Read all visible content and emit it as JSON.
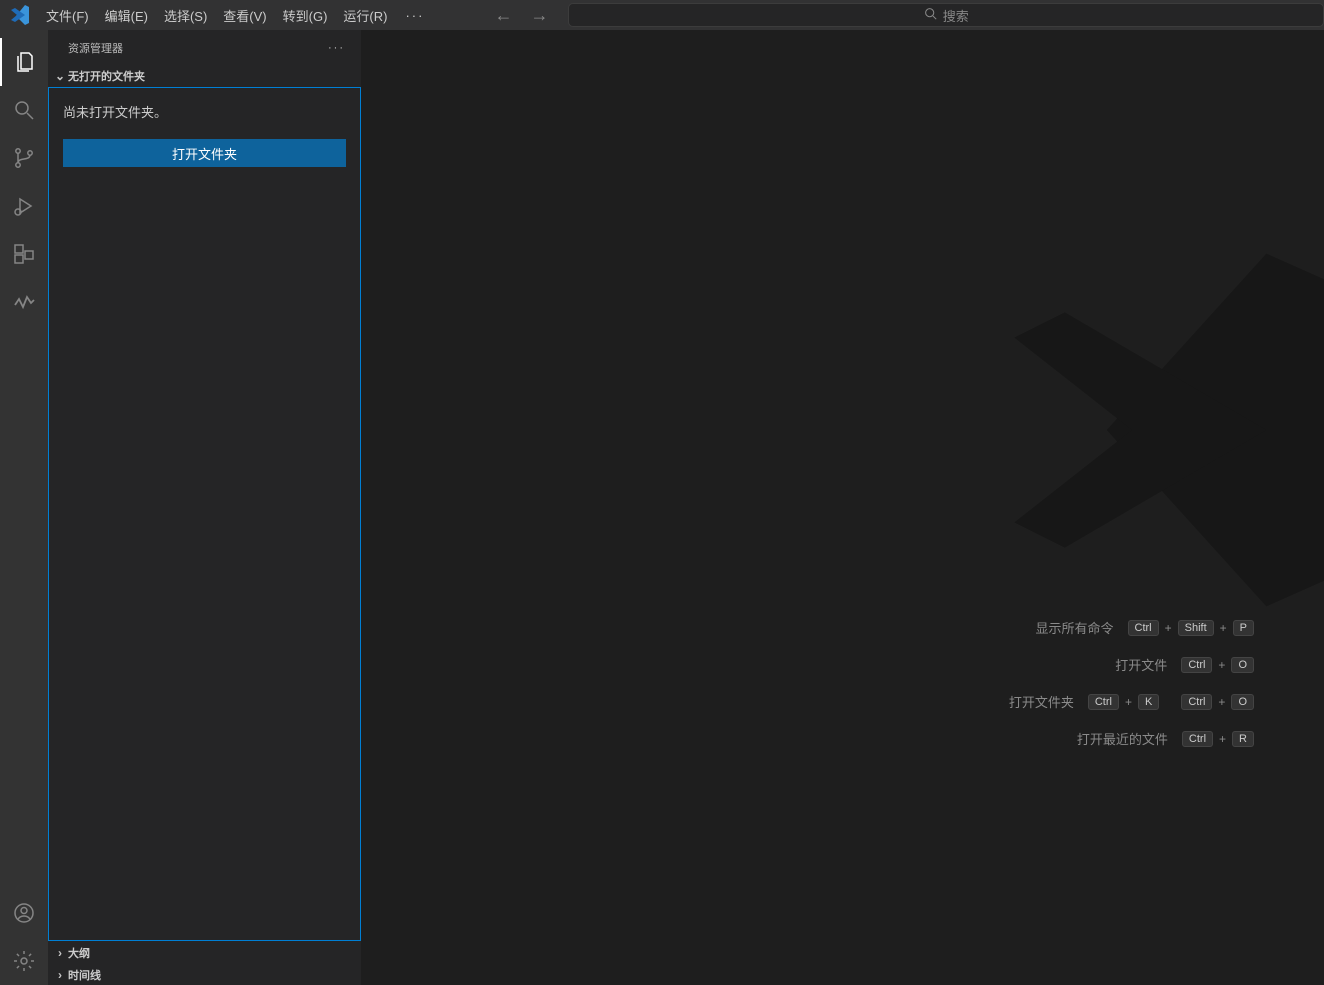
{
  "menubar": {
    "file": "文件(F)",
    "edit": "编辑(E)",
    "selection": "选择(S)",
    "view": "查看(V)",
    "go": "转到(G)",
    "run": "运行(R)",
    "more": "···"
  },
  "search": {
    "placeholder": "搜索"
  },
  "sidebar": {
    "title": "资源管理器",
    "more": "···",
    "nofolder_section": "无打开的文件夹",
    "nofolder_text": "尚未打开文件夹。",
    "open_folder_btn": "打开文件夹",
    "outline_section": "大纲",
    "timeline_section": "时间线"
  },
  "shortcuts": [
    {
      "label": "显示所有命令",
      "chords": [
        [
          "Ctrl",
          "Shift",
          "P"
        ]
      ]
    },
    {
      "label": "打开文件",
      "chords": [
        [
          "Ctrl",
          "O"
        ]
      ]
    },
    {
      "label": "打开文件夹",
      "chords": [
        [
          "Ctrl",
          "K"
        ],
        [
          "Ctrl",
          "O"
        ]
      ]
    },
    {
      "label": "打开最近的文件",
      "chords": [
        [
          "Ctrl",
          "R"
        ]
      ]
    }
  ]
}
